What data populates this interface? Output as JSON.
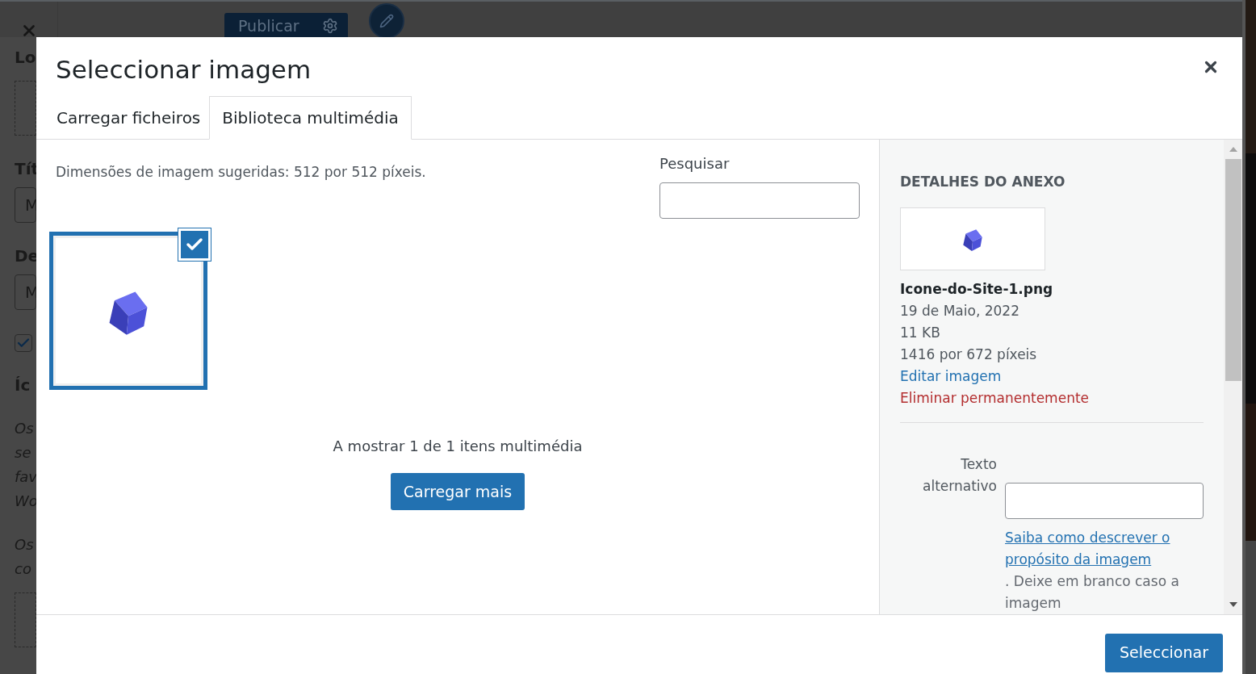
{
  "background": {
    "publish_button": "Publicar",
    "sidebar": [
      {
        "kind": "heading",
        "text": "Lo"
      },
      {
        "kind": "dropzone"
      },
      {
        "kind": "heading",
        "text": "Tít"
      },
      {
        "kind": "field",
        "text": "M"
      },
      {
        "kind": "heading",
        "text": "De"
      },
      {
        "kind": "field",
        "text": "M"
      },
      {
        "kind": "checkbox",
        "checked": true
      },
      {
        "kind": "heading",
        "text": "Íc"
      },
      {
        "kind": "note",
        "lines": [
          "Os",
          "se",
          "fav",
          "Wo"
        ]
      },
      {
        "kind": "note",
        "lines": [
          "Os",
          "co"
        ]
      },
      {
        "kind": "dropzone"
      }
    ]
  },
  "modal": {
    "title": "Seleccionar imagem",
    "tabs": [
      {
        "label": "Carregar ficheiros",
        "selected": false
      },
      {
        "label": "Biblioteca multimédia",
        "selected": true
      }
    ],
    "notice": "Dimensões de imagem sugeridas: 512 por 512 píxeis.",
    "search": {
      "label": "Pesquisar"
    },
    "items": [
      {
        "kind": "picture",
        "selected": true
      }
    ],
    "count": "A mostrar 1 de 1 itens multimédia",
    "load_more": "Carregar mais",
    "details": {
      "heading": "DETALHES DO ANEXO",
      "filename": "Icone-do-Site-1.png",
      "date": "19 de Maio, 2022",
      "size": "11 KB",
      "dimensions": "1416 por 672 píxeis",
      "edit_link": "Editar imagem",
      "delete_link": "Eliminar permanentemente",
      "alt_label": "Texto alternativo",
      "help_link": "Saiba como descrever o propósito da imagem",
      "help_text": ". Deixe em branco caso a imagem"
    },
    "select_button": "Seleccionar"
  }
}
